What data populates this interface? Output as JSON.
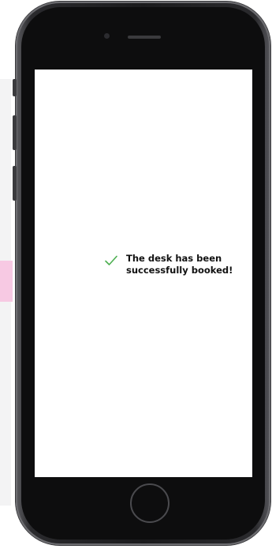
{
  "confirmation": {
    "line1": "The desk has been",
    "line2": "successfully booked!",
    "icon": "check-icon",
    "icon_color": "#4caf50"
  },
  "device": {
    "frame_color": "#1b1b1d",
    "screen_color": "#ffffff"
  }
}
